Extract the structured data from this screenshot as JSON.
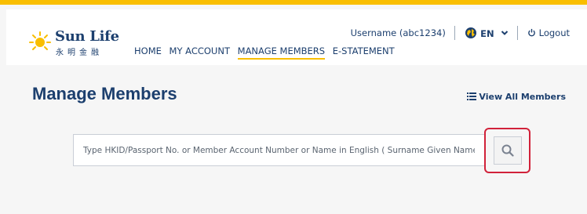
{
  "brand": {
    "name_en": "Sun Life",
    "name_zh": "永明金融",
    "accent": "#f9be00",
    "primary": "#1c3f6e"
  },
  "nav": {
    "items": [
      {
        "label": "HOME"
      },
      {
        "label": "MY ACCOUNT"
      },
      {
        "label": "MANAGE MEMBERS",
        "active": true
      },
      {
        "label": "E-STATEMENT"
      }
    ]
  },
  "user": {
    "username": "Username (abc1234)",
    "language": "EN",
    "logout_label": "Logout"
  },
  "page": {
    "title": "Manage Members",
    "view_all_label": "View All Members"
  },
  "search": {
    "placeholder": "Type HKID/Passport No. or Member Account Number or Name in English ( Surname Given Name)",
    "value": "",
    "button_icon": "search-icon",
    "highlight_color": "#d1223a"
  }
}
